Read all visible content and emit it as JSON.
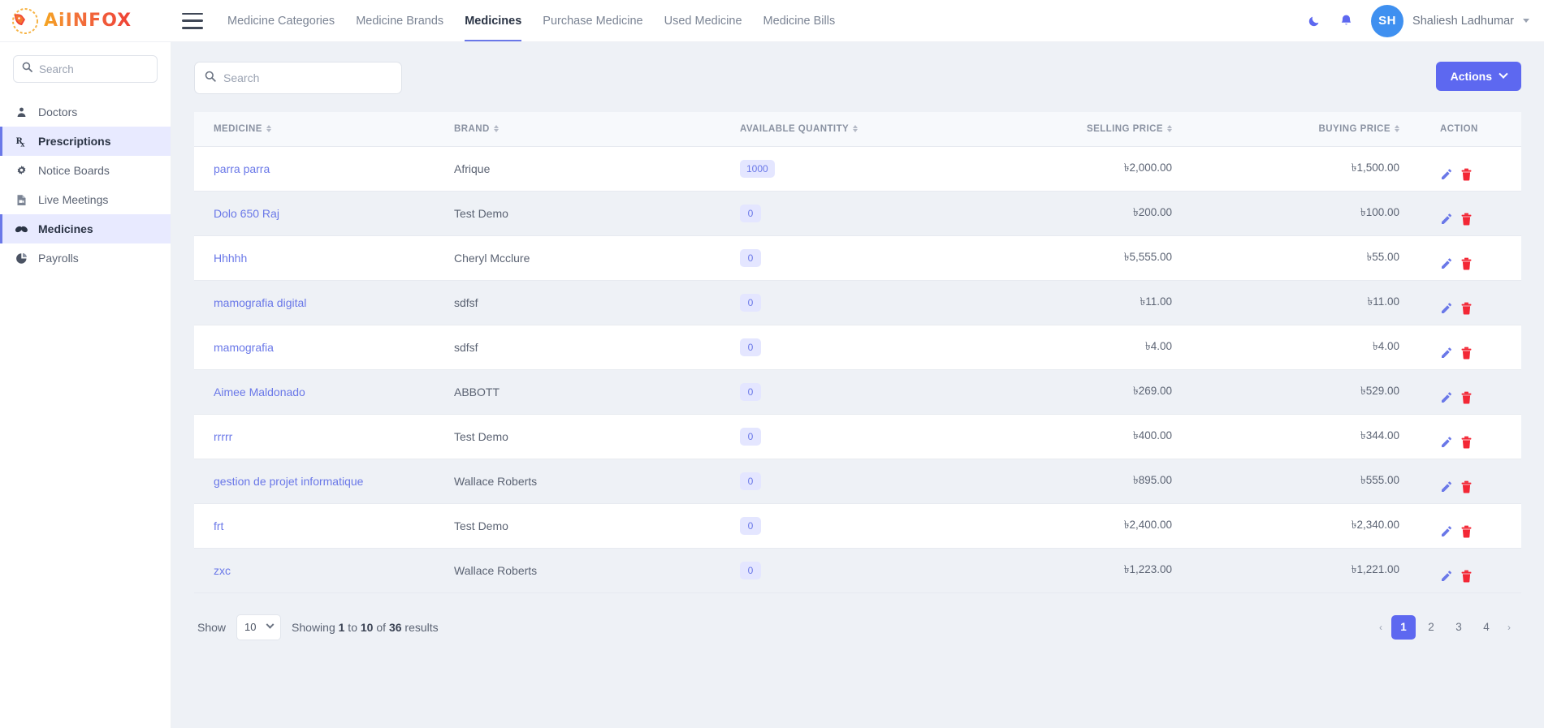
{
  "brand": {
    "word": "AiINFOX",
    "icon": "fox-logo-icon"
  },
  "header": {
    "menu_icon": "hamburger-icon",
    "nav": [
      {
        "label": "Medicine Categories",
        "active": false
      },
      {
        "label": "Medicine Brands",
        "active": false
      },
      {
        "label": "Medicines",
        "active": true
      },
      {
        "label": "Purchase Medicine",
        "active": false
      },
      {
        "label": "Used Medicine",
        "active": false
      },
      {
        "label": "Medicine Bills",
        "active": false
      }
    ],
    "dark_mode_icon": "moon-icon",
    "notifications_icon": "bell-icon",
    "avatar_initials": "SH",
    "username": "Shaliesh Ladhumar",
    "user_caret_icon": "chevron-down-icon"
  },
  "sidebar": {
    "search": {
      "placeholder": "Search",
      "value": "",
      "icon": "search-icon"
    },
    "items": [
      {
        "label": "Doctors",
        "icon": "doctor-icon",
        "active": false
      },
      {
        "label": "Prescriptions",
        "icon": "prescription-rx-icon",
        "active": true
      },
      {
        "label": "Notice Boards",
        "icon": "gear-icon",
        "active": false
      },
      {
        "label": "Live Meetings",
        "icon": "file-video-icon",
        "active": false
      },
      {
        "label": "Medicines",
        "icon": "pills-icon",
        "active": true
      },
      {
        "label": "Payrolls",
        "icon": "pie-chart-icon",
        "active": false
      }
    ]
  },
  "toolbar": {
    "search": {
      "placeholder": "Search",
      "value": "",
      "icon": "search-icon"
    },
    "actions_label": "Actions",
    "actions_caret_icon": "chevron-down-icon"
  },
  "table": {
    "columns": [
      {
        "label": "MEDICINE",
        "sortable": true
      },
      {
        "label": "BRAND",
        "sortable": true
      },
      {
        "label": "AVAILABLE QUANTITY",
        "sortable": true
      },
      {
        "label": "SELLING PRICE",
        "sortable": true
      },
      {
        "label": "BUYING PRICE",
        "sortable": true
      },
      {
        "label": "ACTION",
        "sortable": false
      }
    ],
    "rows": [
      {
        "medicine": "parra parra",
        "brand": "Afrique",
        "quantity": "1000",
        "selling": "৳2,000.00",
        "buying": "৳1,500.00"
      },
      {
        "medicine": "Dolo 650 Raj",
        "brand": "Test Demo",
        "quantity": "0",
        "selling": "৳200.00",
        "buying": "৳100.00"
      },
      {
        "medicine": "Hhhhh",
        "brand": "Cheryl Mcclure",
        "quantity": "0",
        "selling": "৳5,555.00",
        "buying": "৳55.00"
      },
      {
        "medicine": "mamografia digital",
        "brand": "sdfsf",
        "quantity": "0",
        "selling": "৳11.00",
        "buying": "৳11.00"
      },
      {
        "medicine": "mamografia",
        "brand": "sdfsf",
        "quantity": "0",
        "selling": "৳4.00",
        "buying": "৳4.00"
      },
      {
        "medicine": "Aimee Maldonado",
        "brand": "ABBOTT",
        "quantity": "0",
        "selling": "৳269.00",
        "buying": "৳529.00"
      },
      {
        "medicine": "rrrrr",
        "brand": "Test Demo",
        "quantity": "0",
        "selling": "৳400.00",
        "buying": "৳344.00"
      },
      {
        "medicine": "gestion de projet informatique",
        "brand": "Wallace Roberts",
        "quantity": "0",
        "selling": "৳895.00",
        "buying": "৳555.00"
      },
      {
        "medicine": "frt",
        "brand": "Test Demo",
        "quantity": "0",
        "selling": "৳2,400.00",
        "buying": "৳2,340.00"
      },
      {
        "medicine": "zxc",
        "brand": "Wallace Roberts",
        "quantity": "0",
        "selling": "৳1,223.00",
        "buying": "৳1,221.00"
      }
    ],
    "row_actions": {
      "edit_icon": "edit-pencil-icon",
      "delete_icon": "trash-icon"
    }
  },
  "footer": {
    "show_label": "Show",
    "page_size": "10",
    "page_size_caret_icon": "chevron-down-icon",
    "showing_text": "Showing 1 to 10 of 36 results",
    "showing_parts": {
      "prefix": "Showing ",
      "from": "1",
      "mid1": " to ",
      "to": "10",
      "mid2": " of ",
      "total": "36",
      "suffix": " results"
    },
    "pagination": {
      "prev_icon": "chevron-left-icon",
      "next_icon": "chevron-right-icon",
      "pages": [
        "1",
        "2",
        "3",
        "4"
      ],
      "current": "1"
    }
  },
  "colors": {
    "accent": "#5d68f0",
    "link": "#6a78e8",
    "sidebar_active_bg": "#e8eaff",
    "danger": "#f32735",
    "avatar_bg": "#3f90f0",
    "page_bg": "#eef1f6"
  }
}
